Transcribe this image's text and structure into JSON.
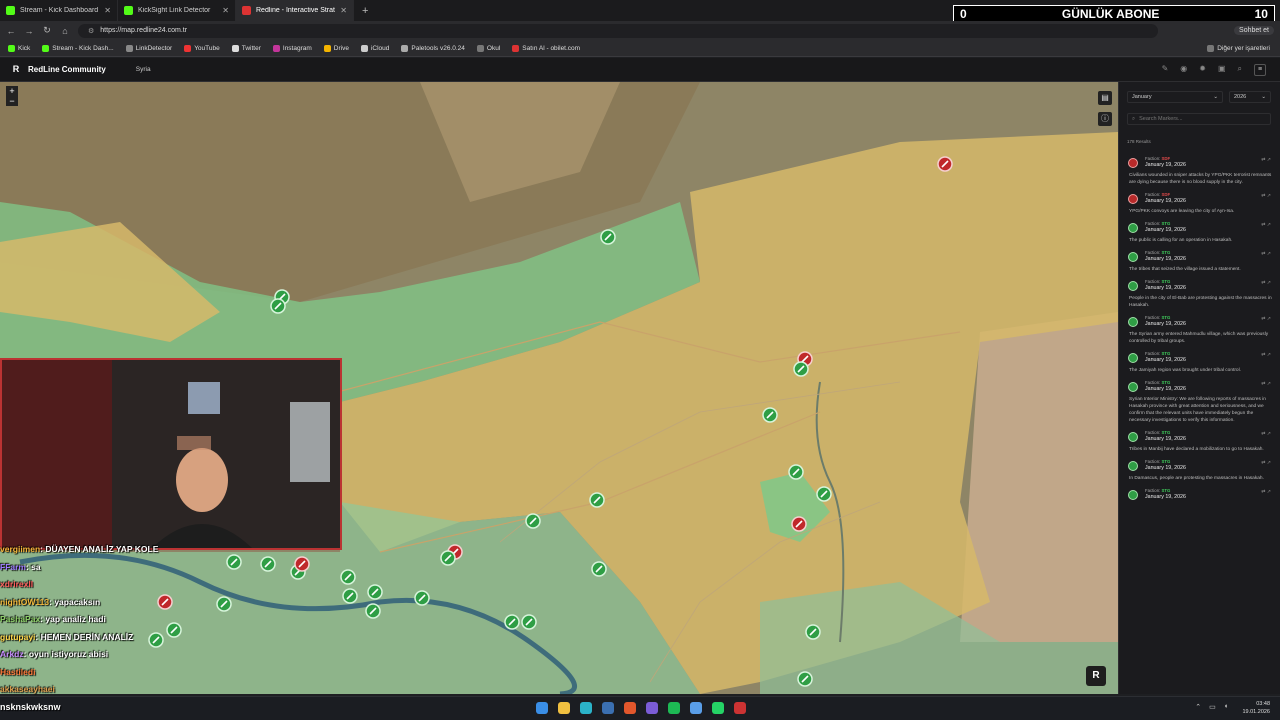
{
  "browser": {
    "tabs": [
      {
        "title": "Stream - Kick Dashboard",
        "active": false
      },
      {
        "title": "KickSight Link Detector",
        "active": false
      },
      {
        "title": "Redline - Interactive Strategic Map",
        "active": true
      }
    ],
    "new_tab": "+",
    "url": "https://map.redline24.com.tr",
    "profile_label": "Sohbet et",
    "bookmarks": [
      "Kick",
      "Stream - Kick Dash...",
      "LinkDetector",
      "YouTube",
      "Twitter",
      "Instagram",
      "Drive",
      "iCloud",
      "Paletools v26.0.24",
      "Okul",
      "Satın Al - obilet.com"
    ],
    "bookmarks_right": "Diğer yer işaretleri"
  },
  "banner": {
    "left": "0",
    "title": "GÜNLÜK ABONE",
    "right": "10"
  },
  "site": {
    "logo": "R",
    "brand": "RedLine Community",
    "nav": "Syria"
  },
  "map": {
    "zoom_in": "+",
    "zoom_out": "−",
    "badge": "R",
    "colors": {
      "sdf_zone": "#d6b96a",
      "gov_zone": "#7fc98a",
      "marker_green": "#2f9e45",
      "marker_red": "#c0282b"
    }
  },
  "sidebar": {
    "month": "January",
    "year": "2026",
    "search_placeholder": "Search Markers...",
    "results": "178 Results",
    "items": [
      {
        "faction": "SDF",
        "color": "red",
        "date": "January 19, 2026",
        "text": "Civilians wounded in sniper attacks by YPG/PKK terrorist remnants are dying because there is no blood supply in the city."
      },
      {
        "faction": "SDF",
        "color": "red",
        "date": "January 19, 2026",
        "text": "YPG/PKK convoys are leaving the city of Ayn-Isa."
      },
      {
        "faction": "STG",
        "color": "green",
        "date": "January 19, 2026",
        "text": "The public is calling for an operation in Hasakah."
      },
      {
        "faction": "STG",
        "color": "green",
        "date": "January 19, 2026",
        "text": "The tribes that seized the village issued a statement."
      },
      {
        "faction": "STG",
        "color": "green",
        "date": "January 19, 2026",
        "text": "People in the city of El-Bab are protesting against the massacres in Hasakah."
      },
      {
        "faction": "STG",
        "color": "green",
        "date": "January 19, 2026",
        "text": "The Syrian army entered Mahmudlu village, which was previously controlled by tribal groups."
      },
      {
        "faction": "STG",
        "color": "green",
        "date": "January 19, 2026",
        "text": "The Jamiyah region was brought under tribal control."
      },
      {
        "faction": "STG",
        "color": "green",
        "date": "January 19, 2026",
        "text": "Syrian Interior Ministry: We are following reports of massacres in Hasakah province with great attention and seriousness, and we confirm that the relevant units have immediately begun the necessary investigations to verify this information."
      },
      {
        "faction": "STG",
        "color": "green",
        "date": "January 19, 2026",
        "text": "Tribes in Manbij have declared a mobilization to go to Hasakah."
      },
      {
        "faction": "STG",
        "color": "green",
        "date": "January 19, 2026",
        "text": "In Damascus, people are protesting the massacres in Hasakah."
      },
      {
        "faction": "STG",
        "color": "green",
        "date": "January 19, 2026",
        "text": ""
      }
    ],
    "faction_prefix": "Faction:"
  },
  "chat": [
    {
      "user": "vergiimen",
      "msg": ": DÜAYEN ANALİZ YAP KOLE"
    },
    {
      "user": "FFarm",
      "msg": ": sa"
    },
    {
      "user": "xdrirexIl",
      "msg": ""
    },
    {
      "user": "nightOW113",
      "msg": ": yapacaksın"
    },
    {
      "user": "PashaPax",
      "msg": ": yap analiz hadi"
    },
    {
      "user": "gutupayi",
      "msg": ": HEMEN DERİN ANALİZ"
    },
    {
      "user": "Arkdz",
      "msg": ": oyun istiyoruz abisi"
    },
    {
      "user": "Hastiledi",
      "msg": ""
    },
    {
      "user": "akkaseayhaei",
      "msg": ""
    }
  ],
  "taskbar": {
    "overlay_text": "nsknskwksnw",
    "time": "03:48",
    "date": "19.01.2026"
  }
}
